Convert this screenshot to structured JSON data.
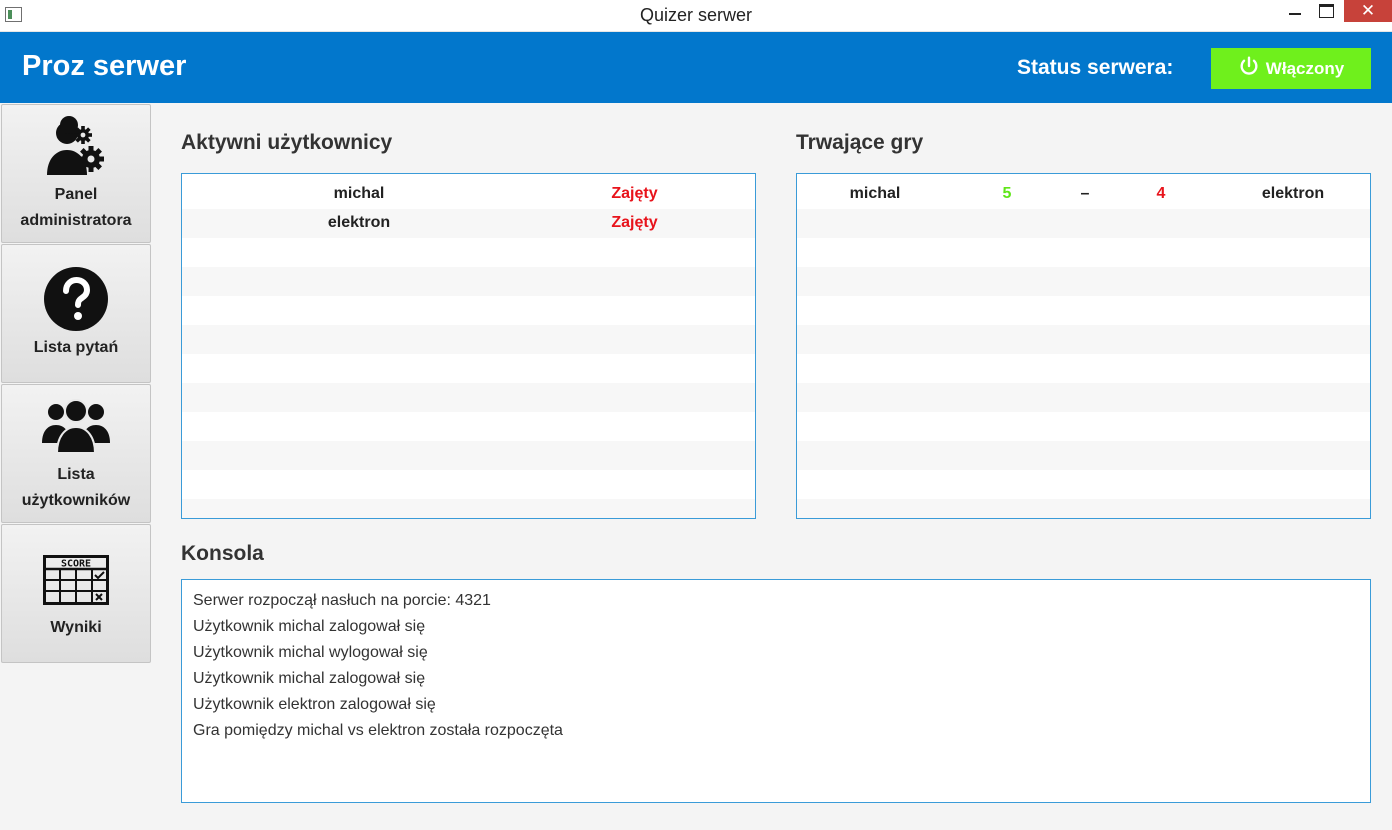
{
  "window": {
    "title": "Quizer serwer",
    "close_glyph": "✕"
  },
  "header": {
    "brand": "Proz serwer",
    "status_label": "Status serwera:",
    "status_button": "Włączony",
    "status_color": "#6ff01c",
    "accent_color": "#0277cc"
  },
  "sidebar": {
    "items": [
      {
        "label_line1": "Panel",
        "label_line2": "administratora",
        "icon": "admin-gear-icon"
      },
      {
        "label_line1": "Lista pytań",
        "icon": "question-icon"
      },
      {
        "label_line1": "Lista",
        "label_line2": "użytkowników",
        "icon": "users-icon"
      },
      {
        "label_line1": "Wyniki",
        "icon": "score-icon",
        "icon_text": "SCORE"
      }
    ]
  },
  "active_users": {
    "title": "Aktywni użytkownicy",
    "rows": [
      {
        "name": "michal",
        "status": "Zajęty"
      },
      {
        "name": "elektron",
        "status": "Zajęty"
      }
    ],
    "status_color": "#e8131b"
  },
  "games": {
    "title": "Trwające gry",
    "rows": [
      {
        "player1": "michal",
        "score1": "5",
        "separator": "–",
        "score2": "4",
        "player2": "elektron"
      }
    ],
    "winner_color": "#5ee617",
    "loser_color": "#e8131b"
  },
  "console": {
    "title": "Konsola",
    "lines": [
      "Serwer rozpoczął nasłuch na porcie: 4321",
      "Użytkownik michal zalogował się",
      "Użytkownik michal wylogował się",
      "Użytkownik michal zalogował się",
      "Użytkownik elektron zalogował się",
      "Gra pomiędzy michal vs elektron została rozpoczęta"
    ]
  }
}
